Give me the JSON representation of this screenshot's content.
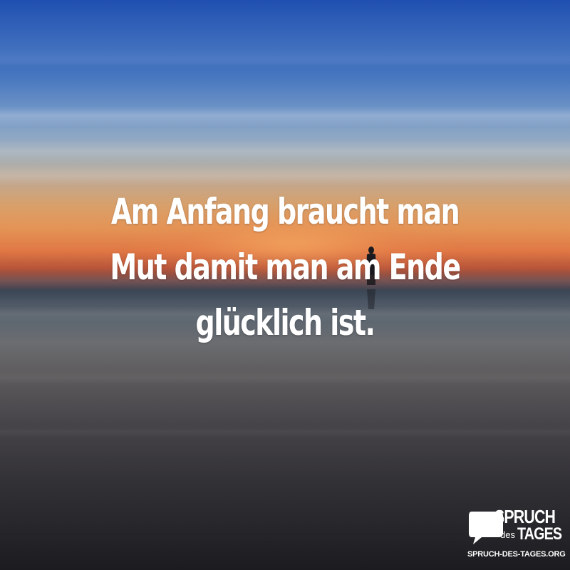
{
  "quote": {
    "lines": [
      "Am Anfang braucht man",
      "Mut damit man am Ende",
      "glücklich ist."
    ]
  },
  "logo": {
    "word_top": "SPRUCH",
    "word_small": "des",
    "word_bottom": "TAGES",
    "url": "SPRUCH-DES-TAGES.ORG"
  },
  "colors": {
    "text": "#ffffff",
    "sky_top": "#1f4fb0",
    "sunset": "#e07845",
    "water_dark": "#1c1b1f"
  }
}
